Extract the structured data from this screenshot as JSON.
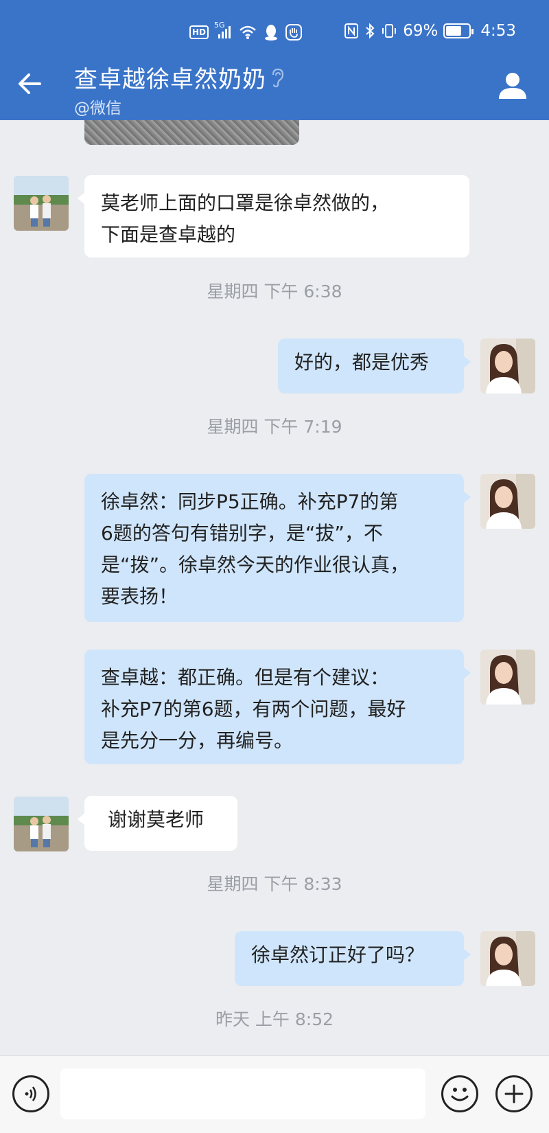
{
  "status_bar": {
    "hd": "HD",
    "network": "5G",
    "battery_percent": "69%",
    "battery_level": 0.69,
    "time": "4:53"
  },
  "header": {
    "title": "查卓越徐卓然奶奶",
    "subtitle": "@微信"
  },
  "messages": [
    {
      "dir": "in",
      "text_lines": [
        "莫老师上面的口罩是徐卓然做的，",
        "下面是查卓越的"
      ]
    },
    {
      "timestamp": "星期四  下午 6:38"
    },
    {
      "dir": "out",
      "text_lines": [
        "好的，都是优秀"
      ]
    },
    {
      "timestamp": "星期四  下午 7:19"
    },
    {
      "dir": "out",
      "text_lines": [
        "徐卓然：同步P5正确。补充P7的第",
        "6题的答句有错别字，是“拔”，不",
        "是“拨”。徐卓然今天的作业很认真，",
        "要表扬！"
      ]
    },
    {
      "dir": "out",
      "text_lines": [
        "查卓越：都正确。但是有个建议：",
        "补充P7的第6题，有两个问题，最好",
        "是先分一分，再编号。"
      ]
    },
    {
      "dir": "in",
      "text_lines": [
        "谢谢莫老师"
      ]
    },
    {
      "timestamp": "星期四  下午 8:33"
    },
    {
      "dir": "out",
      "text_lines": [
        "徐卓然订正好了吗？"
      ]
    },
    {
      "timestamp": "昨天  上午 8:52"
    }
  ],
  "input": {
    "value": "",
    "placeholder": ""
  },
  "colors": {
    "header": "#3a74c9",
    "bubble_out": "#cfe5fb",
    "bubble_in": "#ffffff",
    "background": "#ebedf0"
  }
}
